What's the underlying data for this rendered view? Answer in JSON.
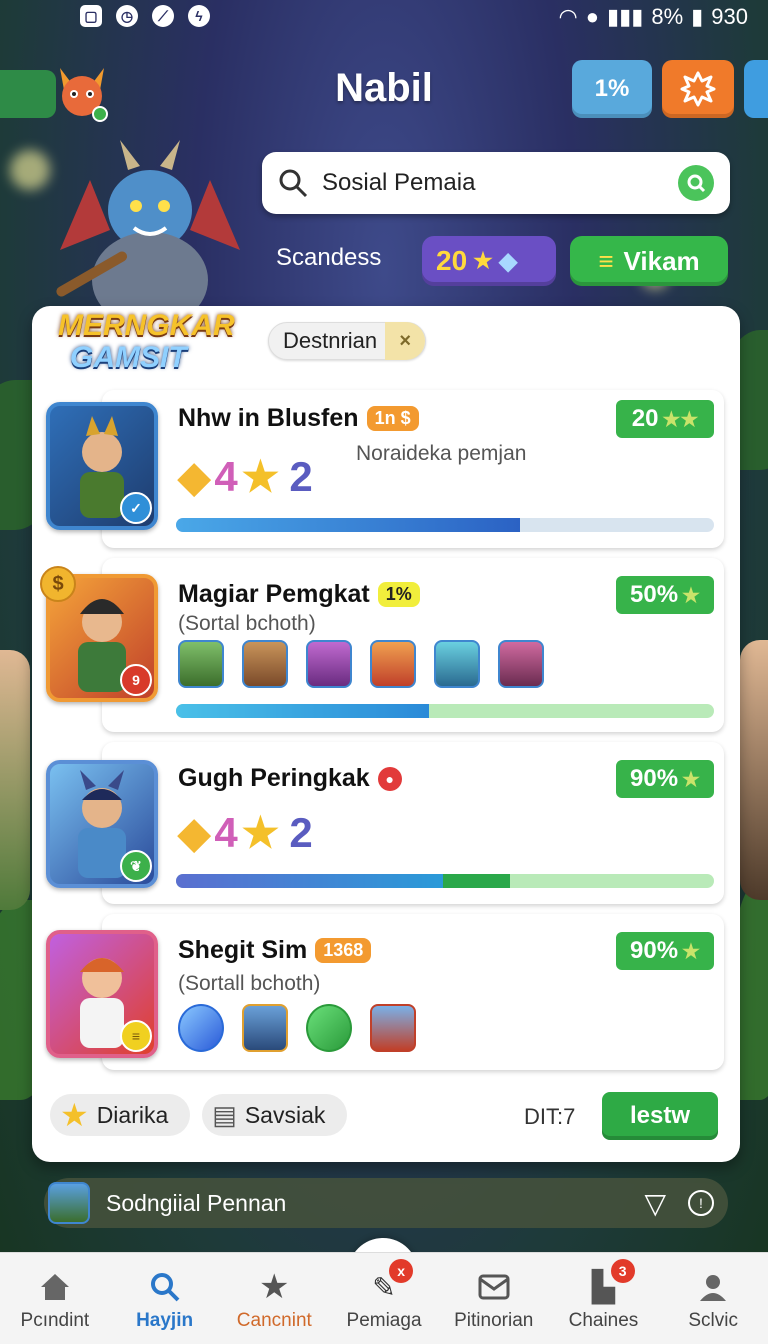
{
  "status_bar": {
    "battery": "8%",
    "time": "930"
  },
  "header": {
    "title": "Nabil",
    "percent_button": "1%",
    "logo_line1": "MERNGKAR",
    "logo_line2": "GAMSIT"
  },
  "search": {
    "value": "Sosial Pemaia"
  },
  "stats": {
    "label": "Scandess",
    "score": "20",
    "action_button": "Vikam"
  },
  "filter_chip": {
    "label": "Destnrian",
    "close": "×"
  },
  "cards": [
    {
      "title": "Nhw in Blusfen",
      "tag": "1n $",
      "subtitle": "Noraideka pemjan",
      "rating_a": "4",
      "rating_b": "2",
      "percent": "20",
      "progress": 0.64
    },
    {
      "title": "Magiar Pemgkat",
      "tag": "1%",
      "subtitle": "(Sortal bchoth)",
      "percent": "50%",
      "image_badge": "9",
      "progress": 0.47
    },
    {
      "title": "Gugh Peringkak",
      "tag": "",
      "rating_a": "4",
      "rating_b": "2",
      "percent": "90%",
      "progress": 0.62
    },
    {
      "title": "Shegit Sim",
      "tag": "1368",
      "subtitle": "(Sortall bchoth)",
      "percent": "90%"
    }
  ],
  "footer_actions": {
    "favorites": "Diarika",
    "save": "Savsiak",
    "counter": "DIT:7",
    "primary": "lestw"
  },
  "ticker": {
    "text": "Sodngiial Pennan"
  },
  "nav": {
    "items": [
      {
        "label": "Pcındint",
        "icon": "home-icon"
      },
      {
        "label": "Hayjin",
        "icon": "search-icon"
      },
      {
        "label": "Cancnint",
        "icon": "star-icon"
      },
      {
        "label": "Pemiaga",
        "icon": "edit-icon"
      },
      {
        "label": "Pitinorian",
        "icon": "mail-icon"
      },
      {
        "label": "Chaines",
        "icon": "trophy-icon"
      },
      {
        "label": "Sclvic",
        "icon": "profile-icon"
      }
    ],
    "badge_center": "x",
    "badge_chaines": "3"
  },
  "colors": {
    "accent_green": "#37b34a",
    "accent_blue": "#2a77c9",
    "accent_orange": "#f07a2a",
    "score_purple": "#6a4fc4"
  }
}
